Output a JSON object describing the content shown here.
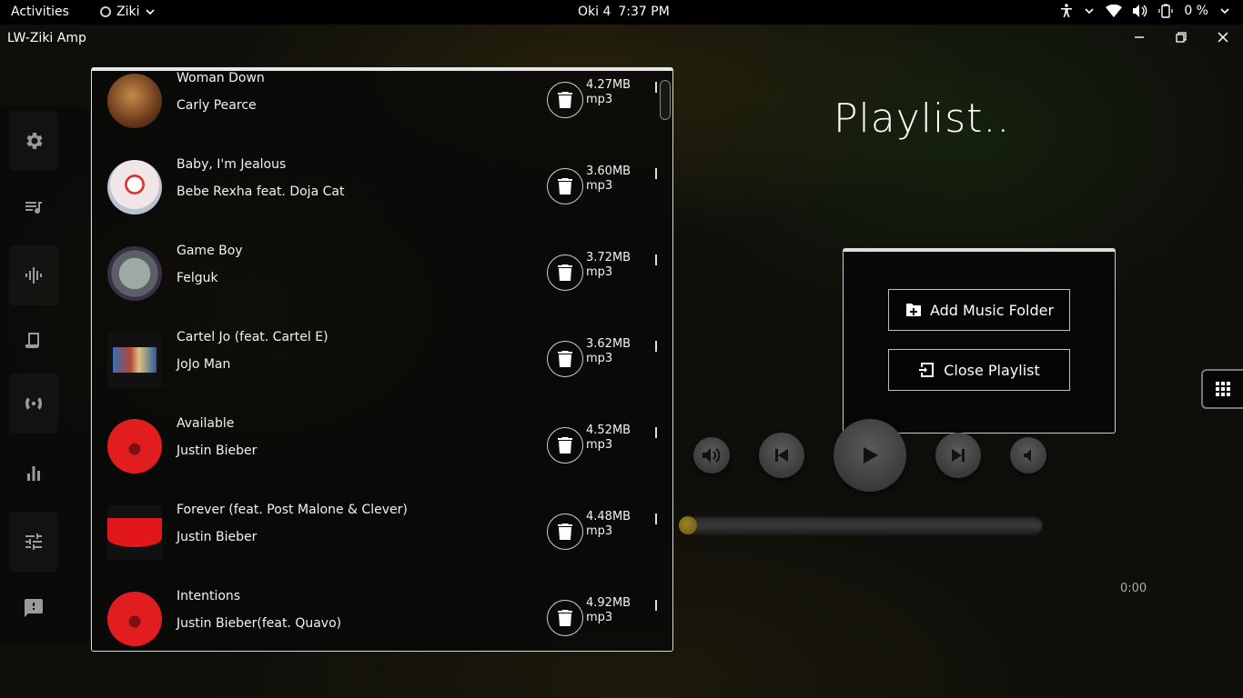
{
  "topbar": {
    "activities": "Activities",
    "app_name": "Ziki",
    "date": "Oki 4",
    "time": "7:37 PM",
    "battery": "0 %"
  },
  "window": {
    "title": "LW-Ziki Amp"
  },
  "heading": "Playlist..",
  "tracks": [
    {
      "title": "Woman Down",
      "artist": "Carly Pearce",
      "size": "4.27MB",
      "format": "mp3"
    },
    {
      "title": "Baby, I'm Jealous",
      "artist": "Bebe Rexha feat. Doja Cat",
      "size": "3.60MB",
      "format": "mp3"
    },
    {
      "title": "Game Boy",
      "artist": "Felguk",
      "size": "3.72MB",
      "format": "mp3"
    },
    {
      "title": "Cartel Jo (feat. Cartel E)",
      "artist": "JoJo Man",
      "size": "3.62MB",
      "format": "mp3"
    },
    {
      "title": "Available",
      "artist": "Justin Bieber",
      "size": "4.52MB",
      "format": "mp3"
    },
    {
      "title": "Forever (feat. Post Malone & Clever)",
      "artist": "Justin Bieber",
      "size": "4.48MB",
      "format": "mp3"
    },
    {
      "title": "Intentions",
      "artist": "Justin Bieber(feat. Quavo)",
      "size": "4.92MB",
      "format": "mp3"
    }
  ],
  "menu": {
    "add_folder": "Add Music Folder",
    "close_playlist": "Close Playlist"
  },
  "player": {
    "elapsed": "0:00",
    "progress": 0
  },
  "colors": {
    "accent_knob": "#9c8226",
    "panel_border": "#d8d8d8"
  },
  "icons": {
    "sidebar": [
      "settings-icon",
      "playlist-icon",
      "waveform-icon",
      "lyrics-scroll-icon",
      "radio-broadcast-icon",
      "equalizer-bars-icon",
      "sliders-icon",
      "feedback-icon"
    ]
  }
}
